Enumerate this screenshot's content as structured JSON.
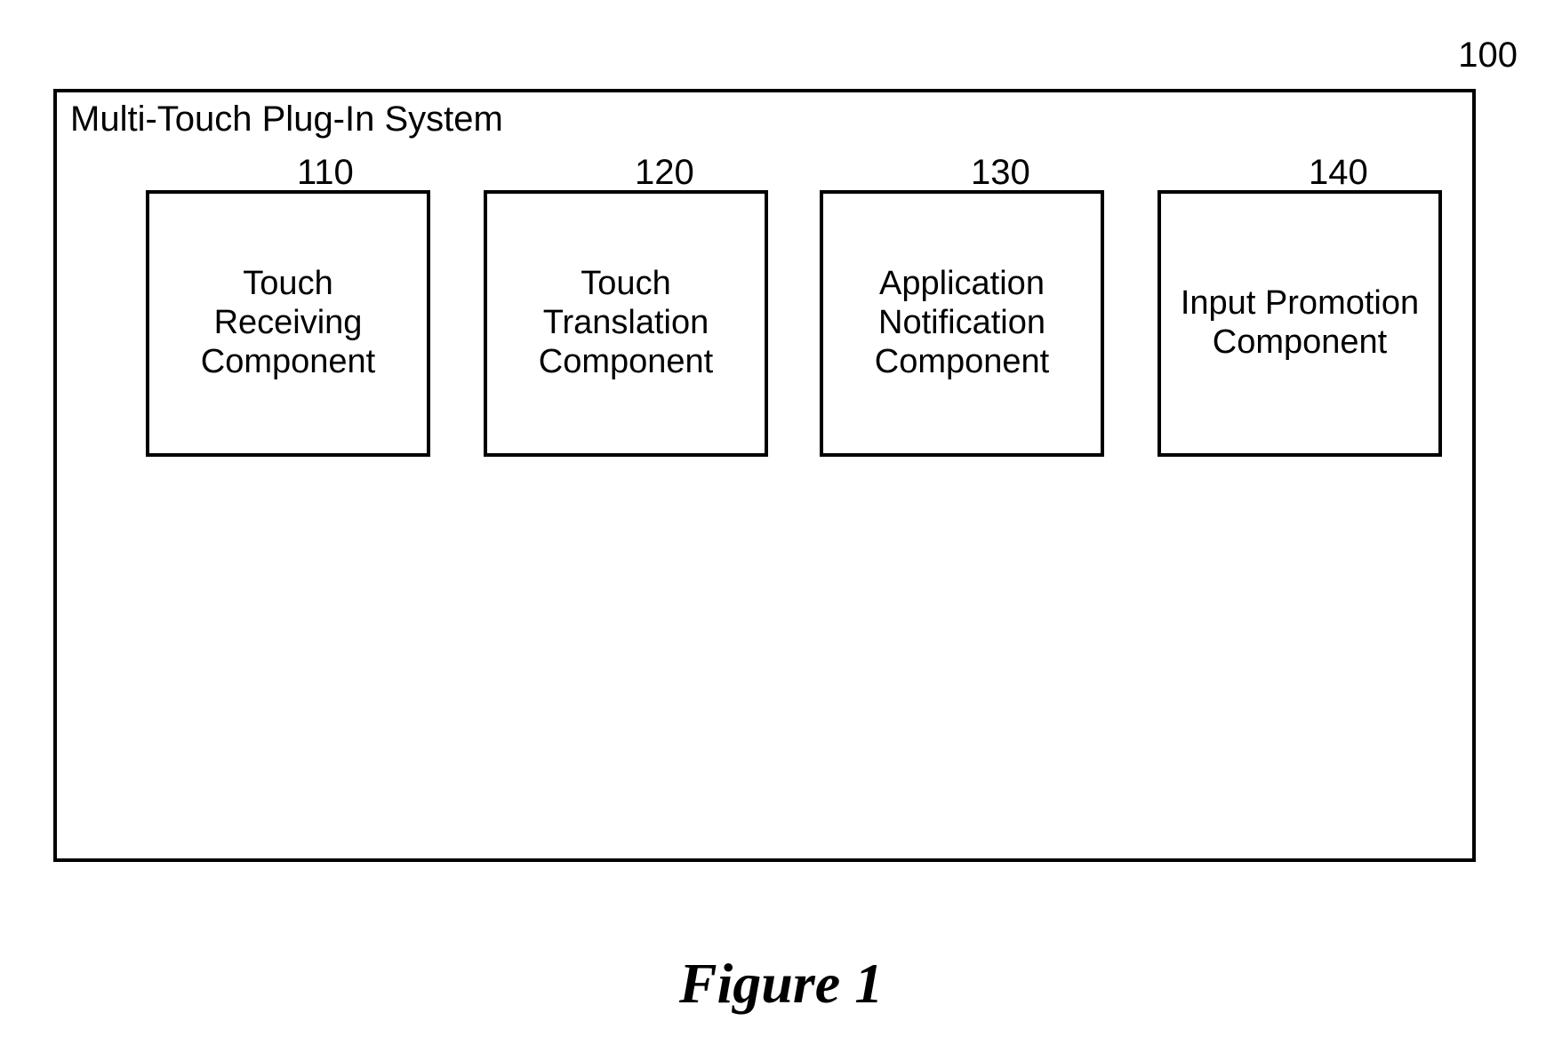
{
  "diagram": {
    "system": {
      "title": "Multi-Touch Plug-In System",
      "ref": "100"
    },
    "components": [
      {
        "ref": "110",
        "label": "Touch Receiving Component"
      },
      {
        "ref": "120",
        "label": "Touch Translation Component"
      },
      {
        "ref": "130",
        "label": "Application Notification Component"
      },
      {
        "ref": "140",
        "label": "Input Promotion Component"
      }
    ],
    "caption": "Figure 1"
  }
}
